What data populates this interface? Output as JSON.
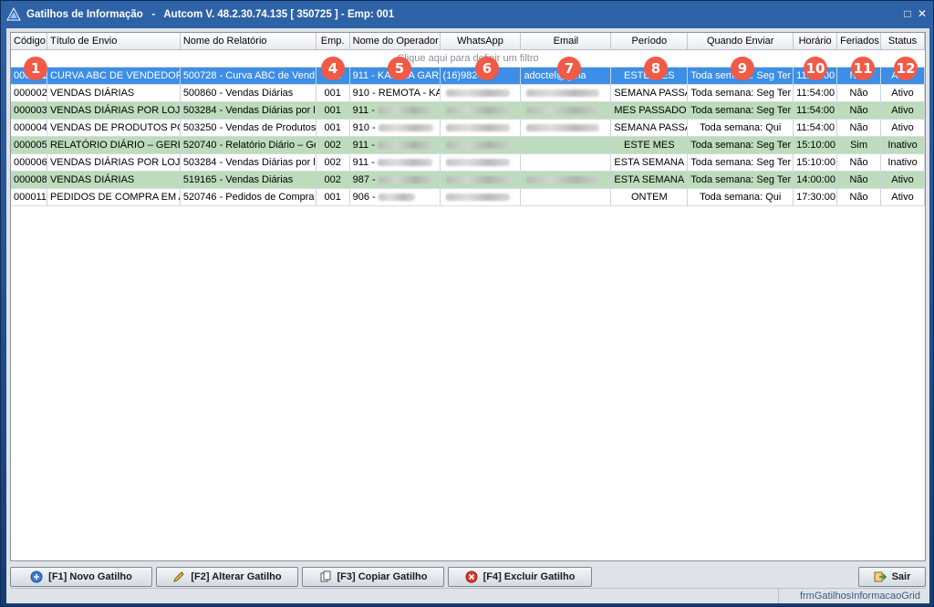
{
  "window": {
    "title": "Gatilhos de Informação   -   Autcom V. 48.2.30.74.135 [ 350725 ] - Emp: 001"
  },
  "grid": {
    "columns": [
      "Código",
      "Título de Envio",
      "Nome do Relatório",
      "Emp.",
      "Nome do Operador",
      "WhatsApp",
      "Email",
      "Período",
      "Quando Enviar",
      "Horário",
      "Feriados",
      "Status"
    ],
    "filter_hint": "Clique aqui para definir um filtro",
    "rows": [
      {
        "codigo": "000001",
        "titulo": "CURVA ABC DE VENDEDORE",
        "relatorio": "500728 - Curva ABC de Vend",
        "emp": "001",
        "operador": "911 - KARINA GAR",
        "whatsapp": "(16)98245-",
        "email": "                 adoctel@gma",
        "periodo": "ESTE MÊS",
        "quando": "Toda semana: Seg Ter",
        "horario": "11:00:00",
        "feriados": "Não",
        "status": "Ativo"
      },
      {
        "codigo": "000002",
        "titulo": "VENDAS DIÁRIAS",
        "relatorio": "500860 - Vendas Diárias",
        "emp": "001",
        "operador": "910 - REMOTA - KA",
        "whatsapp": "",
        "email": "",
        "periodo": "SEMANA PASSA",
        "quando": "Toda semana: Seg Ter",
        "horario": "11:54:00",
        "feriados": "Não",
        "status": "Ativo"
      },
      {
        "codigo": "000003",
        "titulo": "VENDAS DIÁRIAS POR LOJA",
        "relatorio": "503284 - Vendas Diárias por l",
        "emp": "001",
        "operador": "911 -",
        "whatsapp": "",
        "email": "",
        "periodo": "MES PASSADO",
        "quando": "Toda semana: Seg Ter",
        "horario": "11:54:00",
        "feriados": "Não",
        "status": "Ativo"
      },
      {
        "codigo": "000004",
        "titulo": "VENDAS DE PRODUTOS POR",
        "relatorio": "503250 - Vendas de Produtos",
        "emp": "001",
        "operador": "910 -",
        "whatsapp": "",
        "email": "",
        "periodo": "SEMANA PASSA",
        "quando": "Toda semana: Qui",
        "horario": "11:54:00",
        "feriados": "Não",
        "status": "Ativo"
      },
      {
        "codigo": "000005",
        "titulo": "RELATÓRIO DIÁRIO – GERENT",
        "relatorio": "520740 - Relatório Diário – Ge",
        "emp": "002",
        "operador": "911 -",
        "whatsapp": "",
        "email": "",
        "periodo": "ESTE MES",
        "quando": "Toda semana: Seg Ter",
        "horario": "15:10:00",
        "feriados": "Sim",
        "status": "Inativo"
      },
      {
        "codigo": "000006",
        "titulo": "VENDAS DIÁRIAS POR LOJA",
        "relatorio": "503284 - Vendas Diárias por l",
        "emp": "002",
        "operador": "911 -",
        "whatsapp": "",
        "email": "",
        "periodo": "ESTA SEMANA",
        "quando": "Toda semana: Seg Ter",
        "horario": "15:10:00",
        "feriados": "Não",
        "status": "Inativo"
      },
      {
        "codigo": "000008",
        "titulo": "VENDAS DIÁRIAS",
        "relatorio": "519165 - Vendas Diárias",
        "emp": "002",
        "operador": "987 -",
        "whatsapp": "",
        "email": "",
        "periodo": "ESTA SEMANA",
        "quando": "Toda semana: Seg Ter",
        "horario": "14:00:00",
        "feriados": "Não",
        "status": "Ativo"
      },
      {
        "codigo": "000011",
        "titulo": "PEDIDOS DE COMPRA EM AB",
        "relatorio": "520746 - Pedidos de Compra e",
        "emp": "001",
        "operador": "906 -",
        "whatsapp": "",
        "email": "",
        "periodo": "ONTEM",
        "quando": "Toda semana: Qui",
        "horario": "17:30:00",
        "feriados": "Não",
        "status": "Ativo"
      }
    ]
  },
  "badges": [
    "1",
    "4",
    "5",
    "6",
    "7",
    "8",
    "9",
    "10",
    "11",
    "12"
  ],
  "toolbar": {
    "new": "[F1] Novo Gatilho",
    "edit": "[F2] Alterar Gatilho",
    "copy": "[F3] Copiar Gatilho",
    "delete": "[F4] Excluir Gatilho",
    "exit": "Sair"
  },
  "statusbar": {
    "form_name": "frmGatilhosInformacaoGrid"
  },
  "colors": {
    "selected_row": "#3d8ee6",
    "green_row": "#bcdcbc",
    "badge": "#f15a46"
  }
}
